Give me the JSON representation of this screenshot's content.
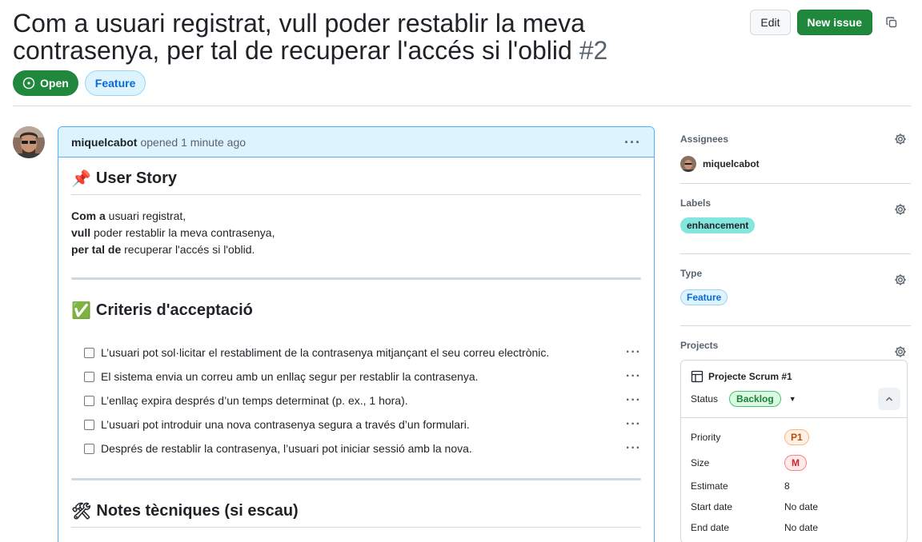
{
  "issue": {
    "title": "Com a usuari registrat, vull poder restablir la meva contrasenya, per tal de recuperar l'accés si l'oblid",
    "number": "#2",
    "state": "Open",
    "type_badge": "Feature"
  },
  "header_actions": {
    "edit_label": "Edit",
    "new_issue_label": "New issue"
  },
  "comment": {
    "author": "miquelcabot",
    "meta": "opened 1 minute ago",
    "user_story_heading": "User Story",
    "user_story_emoji": "📌",
    "story_lines": [
      {
        "bold": "Com a",
        "text": " usuari registrat,"
      },
      {
        "bold": "vull",
        "text": " poder restablir la meva contrasenya,"
      },
      {
        "bold": "per tal de",
        "text": " recuperar l'accés si l'oblid."
      }
    ],
    "criteria_heading": "Criteris d'acceptació",
    "criteria_emoji": "✅",
    "criteria": [
      "L’usuari pot sol·licitar el restabliment de la contrasenya mitjançant el seu correu electrònic.",
      "El sistema envia un correu amb un enllaç segur per restablir la contrasenya.",
      "L’enllaç expira després d’un temps determinat (p. ex., 1 hora).",
      "L’usuari pot introduir una nova contrasenya segura a través d’un formulari.",
      "Després de restablir la contrasenya, l’usuari pot iniciar sessió amb la nova."
    ],
    "notes_heading": "Notes tècniques (si escau)",
    "notes_emoji": "🛠"
  },
  "sidebar": {
    "assignees_label": "Assignees",
    "assignee_name": "miquelcabot",
    "labels_label": "Labels",
    "label_name": "enhancement",
    "type_label": "Type",
    "type_value": "Feature",
    "projects_label": "Projects",
    "project": {
      "name": "Projecte Scrum #1",
      "status_label": "Status",
      "status_value": "Backlog",
      "fields": [
        {
          "key": "Priority",
          "value": "P1"
        },
        {
          "key": "Size",
          "value": "M"
        },
        {
          "key": "Estimate",
          "value": "8"
        },
        {
          "key": "Start date",
          "value": "No date"
        },
        {
          "key": "End date",
          "value": "No date"
        }
      ]
    }
  },
  "colors": {
    "green": "#1f883d",
    "accent_blue": "#0969da",
    "header_bg": "#ddf4ff",
    "label_teal": "#84e7de"
  }
}
